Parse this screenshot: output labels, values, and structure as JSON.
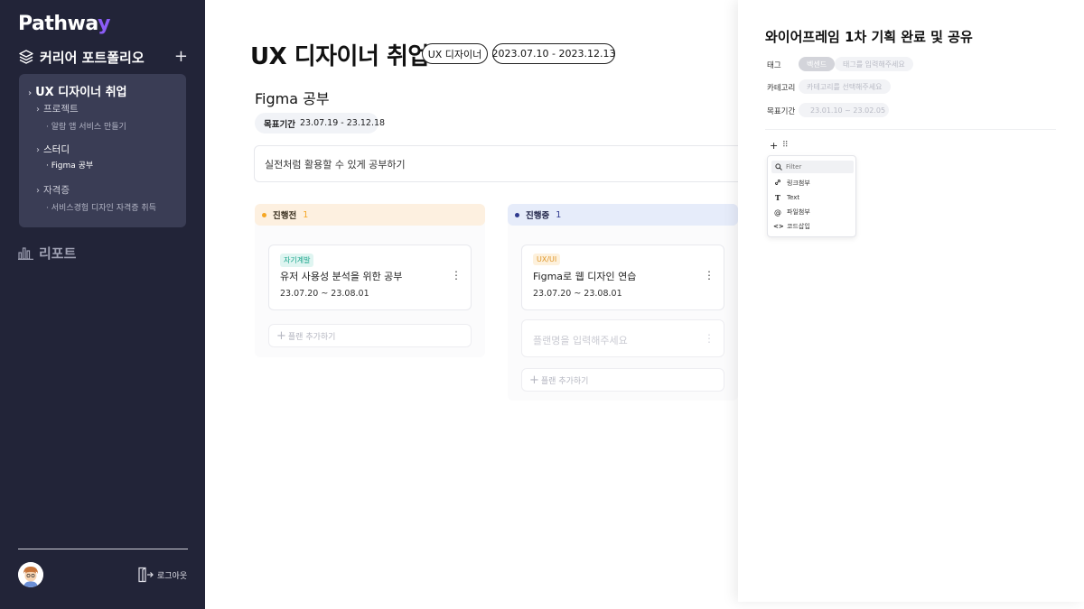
{
  "sidebar": {
    "logo": "Pathway",
    "section_title": "커리어 포트폴리오",
    "project": {
      "title": "UX 디자이너 취업",
      "groups": [
        {
          "label": "프로젝트",
          "items": [
            "알람 앱 서비스 만들기"
          ]
        },
        {
          "label": "스터디",
          "items": [
            "Figma 공부"
          ]
        },
        {
          "label": "자격증",
          "items": [
            "서비스경험 디자인 자격증 취득"
          ]
        }
      ]
    },
    "report_label": "리포트",
    "logout_label": "로그아웃",
    "icons": {
      "portfolio": "layers-icon",
      "add": "plus-icon",
      "report": "bar-chart-icon",
      "logout": "logout-icon",
      "avatar": "user-avatar"
    }
  },
  "main": {
    "title": "UX 디자이너 취업",
    "role_pill": "UX 디자이너",
    "period_pill": "2023.07.10 - 2023.12.13",
    "goal": {
      "title": "Figma 공부",
      "period_label": "목표기간",
      "period_value": "23.07.19 - 23.12.18",
      "description": "실전처럼 활용할 수 있게 공부하기"
    },
    "columns": [
      {
        "label": "진행전",
        "count": "1",
        "color": "#f5a623",
        "cards": [
          {
            "badge": "자기계발",
            "title": "유저 사용성 분석을 위한 공부",
            "date": "23.07.20 ~ 23.08.01"
          }
        ],
        "add_label": "플랜 추가하기"
      },
      {
        "label": "진행중",
        "count": "1",
        "color": "#2f3a8f",
        "cards": [
          {
            "badge": "UX/UI",
            "title": "Figma로 웹 디자인 연습",
            "date": "23.07.20 ~ 23.08.01"
          }
        ],
        "placeholder": "플랜명을 입력해주세요",
        "add_label": "플랜 추가하기"
      }
    ]
  },
  "panel": {
    "title": "와이어프레임 1차 기획 완료 및 공유",
    "tag_label": "태그",
    "tag_chip": "벡센드",
    "tag_placeholder": "태그를 입력해주세요",
    "category_label": "카테고리",
    "category_placeholder": "카테고리를 선택해주세요",
    "period_label": "목표기간",
    "period_value": "23.01.10 ~ 23.02.05",
    "menu": {
      "filter_placeholder": "Filter",
      "items": [
        {
          "icon": "link-icon",
          "label": "링크첨부"
        },
        {
          "icon": "text-icon",
          "label": "Text"
        },
        {
          "icon": "attach-icon",
          "label": "파일첨부"
        },
        {
          "icon": "code-icon",
          "label": "코드삽입"
        }
      ]
    }
  }
}
